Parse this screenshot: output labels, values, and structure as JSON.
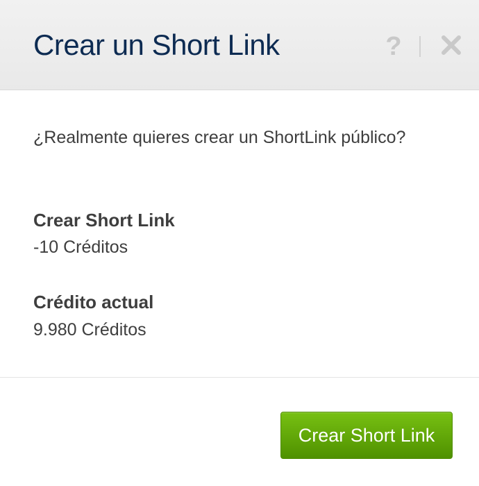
{
  "dialog": {
    "title": "Crear un Short Link",
    "help_glyph": "?",
    "icons": {
      "help": "question-mark-icon",
      "close": "close-x-icon"
    }
  },
  "content": {
    "question": "¿Realmente quieres crear un ShortLink público?",
    "cost_label": "Crear Short Link",
    "cost_value": "-10 Créditos",
    "credit_label": "Crédito actual",
    "credit_value": "9.980 Créditos"
  },
  "footer": {
    "primary_button_label": "Crear Short Link"
  },
  "colors": {
    "title": "#0d2b52",
    "header_background": "#eeeeee",
    "text": "#3e3e3e",
    "button_green": "#5ea600",
    "icon_gray": "#c9c9c9"
  }
}
